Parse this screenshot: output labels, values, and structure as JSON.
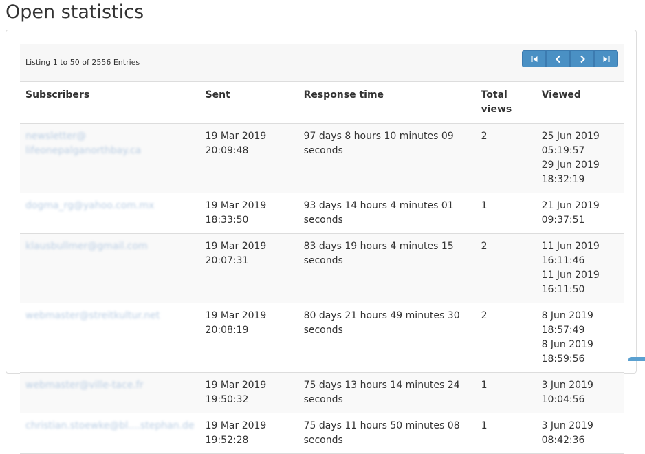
{
  "page": {
    "title": "Open statistics"
  },
  "toolbar": {
    "listing_info": "Listing 1 to 50 of 2556 Entries",
    "pager": [
      {
        "icon": "first-page-icon"
      },
      {
        "icon": "previous-page-icon"
      },
      {
        "icon": "next-page-icon"
      },
      {
        "icon": "last-page-icon"
      }
    ]
  },
  "table": {
    "headers": {
      "subscribers": "Subscribers",
      "sent": "Sent",
      "response_time": "Response time",
      "total_views": "Total views",
      "viewed": "Viewed"
    },
    "rows": [
      {
        "subscriber_l1": "newsletter@",
        "subscriber_l2": "lifeonepalganorthbay.ca",
        "sent_date": "19 Mar 2019",
        "sent_time": "20:09:48",
        "response": "97 days 8 hours 10 minutes 09 seconds",
        "total": "2",
        "viewed_1": "25 Jun 2019 05:19:57",
        "viewed_2": "29 Jun 2019 18:32:19"
      },
      {
        "subscriber_l1": "dogma_rg@yahoo.com.mx",
        "subscriber_l2": "",
        "sent_date": "19 Mar 2019",
        "sent_time": "18:33:50",
        "response": "93 days 14 hours 4 minutes 01 seconds",
        "total": "1",
        "viewed_1": "21 Jun 2019 09:37:51",
        "viewed_2": ""
      },
      {
        "subscriber_l1": "klausbullmer@gmail.com",
        "subscriber_l2": "",
        "sent_date": "19 Mar 2019",
        "sent_time": "20:07:31",
        "response": "83 days 19 hours 4 minutes 15 seconds",
        "total": "2",
        "viewed_1": "11 Jun 2019 16:11:46",
        "viewed_2": "11 Jun 2019 16:11:50"
      },
      {
        "subscriber_l1": "webmaster@streitkultur.net",
        "subscriber_l2": "",
        "sent_date": "19 Mar 2019",
        "sent_time": "20:08:19",
        "response": "80 days 21 hours 49 minutes 30 seconds",
        "total": "2",
        "viewed_1": "8 Jun 2019 18:57:49",
        "viewed_2": "8 Jun 2019 18:59:56"
      },
      {
        "subscriber_l1": "webmaster@ville-tace.fr",
        "subscriber_l2": "",
        "sent_date": "19 Mar 2019",
        "sent_time": "19:50:32",
        "response": "75 days 13 hours 14 minutes 24 seconds",
        "total": "1",
        "viewed_1": "3 Jun 2019 10:04:56",
        "viewed_2": ""
      },
      {
        "subscriber_l1": "christian.stoewke@bl....stephan.de",
        "subscriber_l2": "",
        "sent_date": "19 Mar 2019",
        "sent_time": "19:52:28",
        "response": "75 days 11 hours 50 minutes 08 seconds",
        "total": "1",
        "viewed_1": "3 Jun 2019 08:42:36",
        "viewed_2": ""
      }
    ]
  }
}
